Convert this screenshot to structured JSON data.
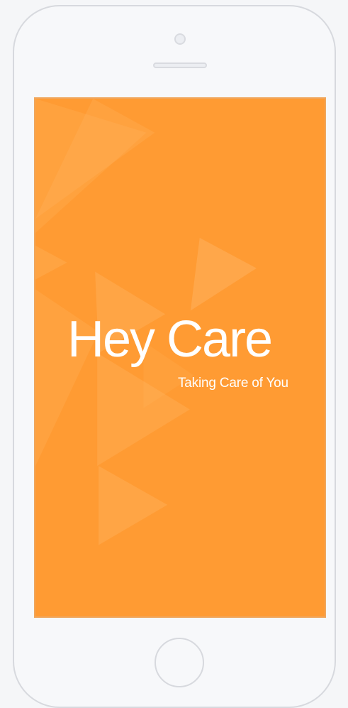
{
  "app": {
    "title": "Hey Care",
    "tagline": "Taking Care of You"
  },
  "colors": {
    "screen_background": "#ff9b33",
    "text": "#ffffff",
    "phone_frame": "#d7d9de"
  },
  "device": {
    "type": "iphone-mockup"
  }
}
